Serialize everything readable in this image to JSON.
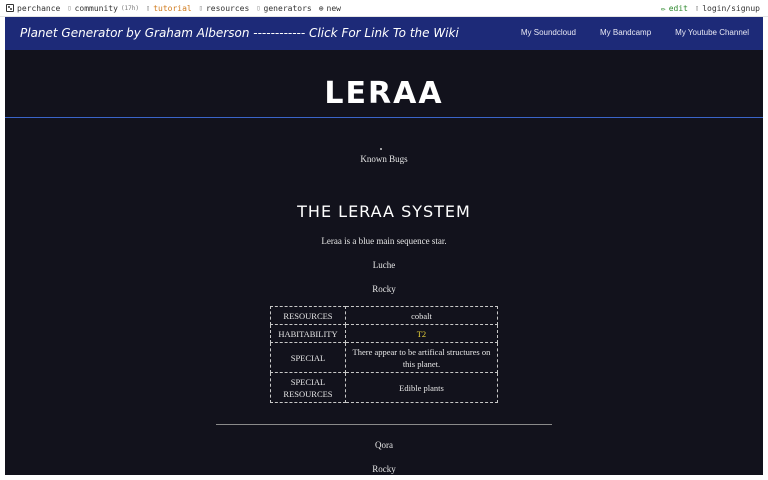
{
  "topbar": {
    "brand": "perchance",
    "community": "community",
    "community_count": "(17h)",
    "tutorial": "tutorial",
    "resources": "resources",
    "generators": "generators",
    "new": "new",
    "edit": "edit",
    "login": "login/signup"
  },
  "navbar": {
    "title": "Planet Generator by Graham Alberson ------------ Click For Link To the Wiki",
    "links": [
      "My Soundcloud",
      "My Bandcamp",
      "My Youtube Channel"
    ]
  },
  "planet_title": "LERAA",
  "known_bugs": "Known Bugs",
  "system_title": "THE LERAA SYSTEM",
  "star_description": "Leraa is a blue main sequence star.",
  "planets": [
    {
      "name": "Luche",
      "type": "Rocky",
      "rows": [
        {
          "key": "RESOURCES",
          "value": "cobalt"
        },
        {
          "key": "HABITABILITY",
          "value": "T2"
        },
        {
          "key": "SPECIAL",
          "value": "There appear to be artifical structures on this planet."
        },
        {
          "key": "SPECIAL RESOURCES",
          "value": "Edible plants"
        }
      ]
    },
    {
      "name": "Qora",
      "type": "Rocky"
    }
  ],
  "colors": {
    "background": "#12121c",
    "navbar": "#1d2a78",
    "habitability": "#e8d23a",
    "accent_line": "#3a64c8"
  }
}
